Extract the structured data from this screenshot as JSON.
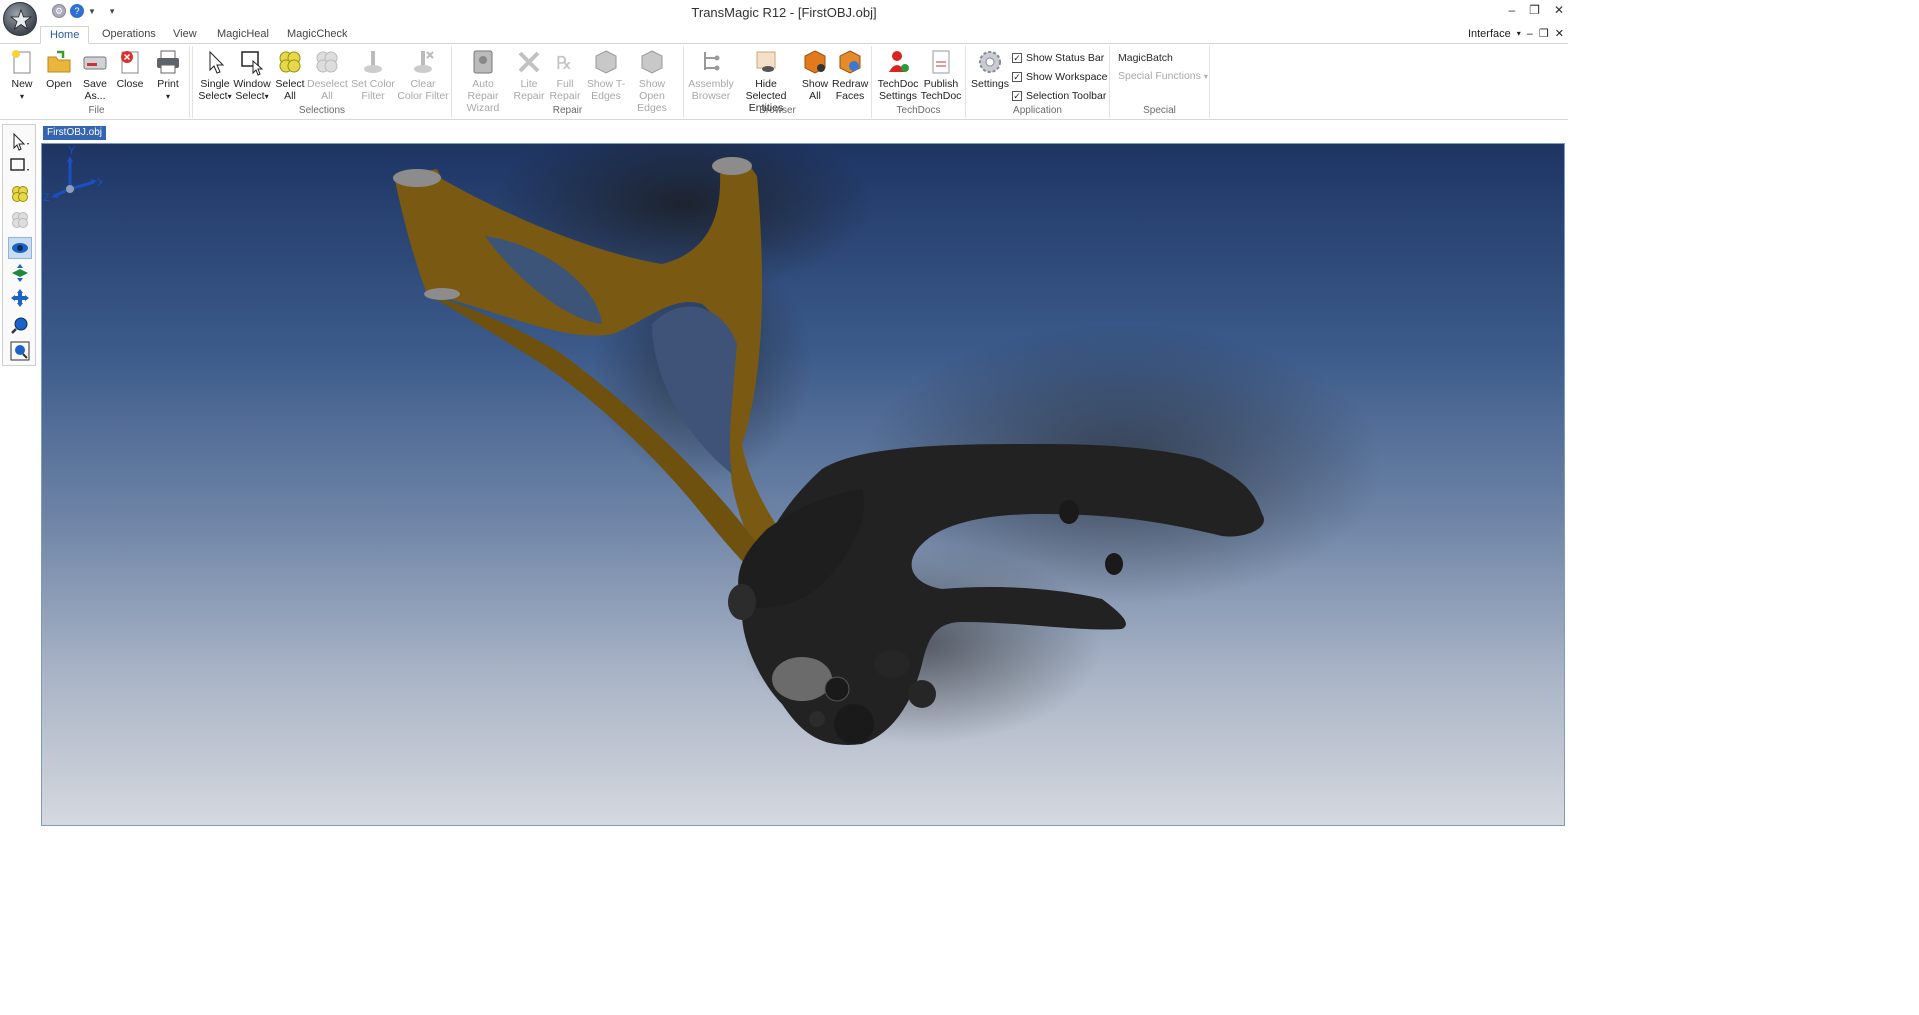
{
  "window": {
    "title": "TransMagic R12 - [FirstOBJ.obj]"
  },
  "tabs": [
    "Home",
    "Operations",
    "View",
    "MagicHeal",
    "MagicCheck"
  ],
  "interface_menu": "Interface",
  "ribbon": {
    "file": {
      "label": "File",
      "new": "New",
      "open": "Open",
      "save_as": "Save As...",
      "close": "Close"
    },
    "print": {
      "label": "Print"
    },
    "selections": {
      "label": "Selections",
      "single": "Single Select",
      "window": "Window Select",
      "select_all": "Select All",
      "deselect_all": "Deselect All",
      "set_color": "Set Color Filter",
      "clear_color": "Clear Color Filter"
    },
    "repair": {
      "label": "Repair",
      "auto": "Auto Repair Wizard",
      "lite": "Lite Repair",
      "full": "Full Repair",
      "t_edges": "Show T-Edges",
      "open_edges": "Show Open Edges"
    },
    "browser": {
      "label": "Browser",
      "assembly": "Assembly Browser",
      "hide": "Hide Selected Entities",
      "show_all": "Show All",
      "redraw": "Redraw Faces"
    },
    "techdocs": {
      "label": "TechDocs",
      "settings": "TechDoc Settings",
      "publish": "Publish TechDoc"
    },
    "application": {
      "label": "Application",
      "settings": "Settings",
      "status_bar": "Show Status Bar",
      "workspace": "Show Workspace",
      "selection_tb": "Selection Toolbar"
    },
    "special": {
      "label": "Special",
      "magicbatch": "MagicBatch",
      "special_functions": "Special Functions"
    }
  },
  "document_tab": "FirstOBJ.obj",
  "axis": {
    "x": "X",
    "y": "Y",
    "z": "Z"
  },
  "colors": {
    "accent": "#3564b2",
    "part_gold": "#7a5a12",
    "part_dark": "#222222"
  }
}
